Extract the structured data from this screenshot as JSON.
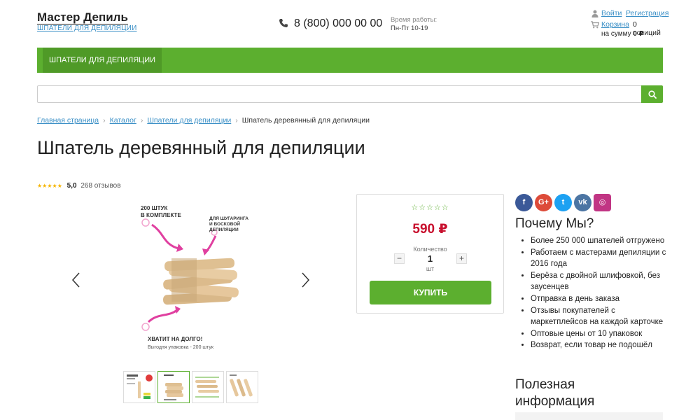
{
  "header": {
    "logo_title": "Мастер Депиль",
    "logo_subtitle": "ШПАТЕЛИ ДЛЯ ДЕПИЛЯЦИИ",
    "phone": "8 (800) 000 00 00",
    "hours_label": "Время работы:",
    "hours_value": "Пн-Пт 10-19",
    "login": "Войти",
    "register": "Регистрация",
    "cart_link": "Корзина",
    "cart_count": "0 позиций",
    "cart_sum_label": "на сумму",
    "cart_sum_value": "0 ₽"
  },
  "nav": {
    "items": [
      {
        "label": "Шпатели для депиляции"
      }
    ]
  },
  "search": {
    "value": "",
    "placeholder": ""
  },
  "breadcrumb": {
    "items": [
      "Главная страница",
      "Каталог",
      "Шпатели для депиляции"
    ],
    "current": "Шпатель деревянный для депиляции"
  },
  "page_title": "Шпатель деревянный для депиляции",
  "rating": {
    "stars": "★★★★★",
    "value": "5,0",
    "count": "268 отзывов"
  },
  "gallery": {
    "image_texts": {
      "top_left": "200 ШТУК В КОМПЛЕКТЕ",
      "top_right": "ДЛЯ ШУГАРИНГА И ВОСКОВОЙ ДЕПИЛЯЦИИ",
      "bottom_bold": "ХВАТИТ НА ДОЛГО!",
      "bottom_small": "Выгодня упаковка - 200 штук"
    },
    "active_thumb": 1
  },
  "buy": {
    "stars": "☆☆☆☆☆",
    "price": "590 ₽",
    "qty_label": "Количество",
    "qty_value": "1",
    "qty_unit": "шт",
    "minus": "−",
    "plus": "+",
    "button": "Купить"
  },
  "social": [
    {
      "name": "facebook",
      "glyph": "f",
      "color": "#3b5998"
    },
    {
      "name": "google-plus",
      "glyph": "G+",
      "color": "#dd4b39"
    },
    {
      "name": "twitter",
      "glyph": "t",
      "color": "#1da1f2"
    },
    {
      "name": "vk",
      "glyph": "vk",
      "color": "#4c75a3"
    },
    {
      "name": "instagram",
      "glyph": "◎",
      "color": "#c13584"
    }
  ],
  "why": {
    "title": "Почему Мы?",
    "items": [
      "Более 250 000 шпателей отгружено",
      "Работаем с мастерами депиляции с 2016 года",
      "Берёза с двойной шлифовкой, без заусенцев",
      "Отправка в день заказа",
      "Отзывы покупателей с маркетплейсов на каждой карточке",
      "Оптовые цены от 10 упаковок",
      "Возврат, если товар не подошёл"
    ]
  },
  "useful": {
    "title": "Полезная информация"
  }
}
